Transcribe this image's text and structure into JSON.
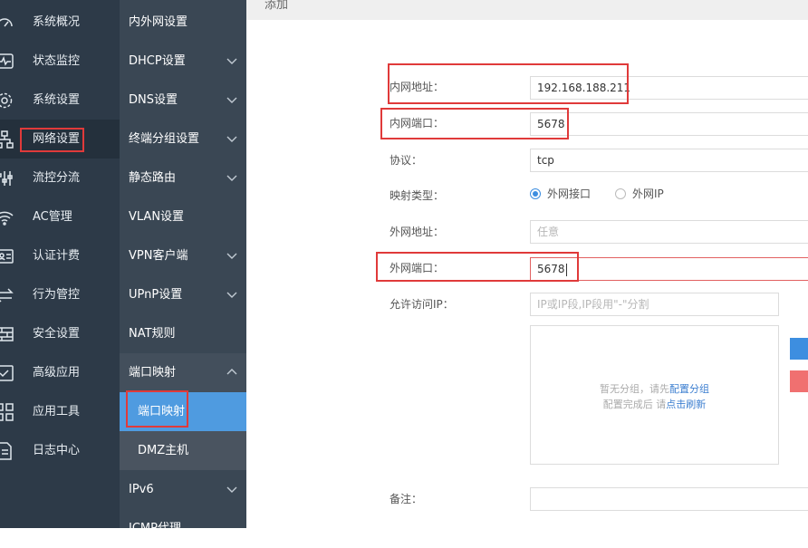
{
  "sidebar": {
    "items": [
      {
        "label": "系统概况",
        "icon": "dashboard-icon"
      },
      {
        "label": "状态监控",
        "icon": "pulse-monitor-icon"
      },
      {
        "label": "系统设置",
        "icon": "gear-icon"
      },
      {
        "label": "网络设置",
        "icon": "network-icon"
      },
      {
        "label": "流控分流",
        "icon": "sliders-icon"
      },
      {
        "label": "AC管理",
        "icon": "wifi-icon"
      },
      {
        "label": "认证计费",
        "icon": "id-card-icon"
      },
      {
        "label": "行为管控",
        "icon": "arrows-exchange-icon"
      },
      {
        "label": "安全设置",
        "icon": "firewall-icon"
      },
      {
        "label": "高级应用",
        "icon": "check-window-icon"
      },
      {
        "label": "应用工具",
        "icon": "tools-grid-icon"
      },
      {
        "label": "日志中心",
        "icon": "log-document-icon"
      }
    ]
  },
  "submenu": {
    "items": [
      {
        "label": "内外网设置"
      },
      {
        "label": "DHCP设置"
      },
      {
        "label": "DNS设置"
      },
      {
        "label": "终端分组设置"
      },
      {
        "label": "静态路由"
      },
      {
        "label": "VLAN设置"
      },
      {
        "label": "VPN客户端"
      },
      {
        "label": "UPnP设置"
      },
      {
        "label": "NAT规则"
      },
      {
        "label": "端口映射"
      },
      {
        "label": "端口映射"
      },
      {
        "label": "DMZ主机"
      },
      {
        "label": "IPv6"
      },
      {
        "label": "ICMP代理"
      }
    ]
  },
  "page": {
    "title": "添加"
  },
  "form": {
    "internal_ip": {
      "label": "内网地址：",
      "value": "192.168.188.211"
    },
    "internal_port": {
      "label": "内网端口：",
      "value": "5678"
    },
    "protocol": {
      "label": "协议：",
      "value": "tcp"
    },
    "mapping_type": {
      "label": "映射类型：",
      "options": [
        "外网接口",
        "外网IP"
      ],
      "selected": "外网接口"
    },
    "external_addr": {
      "label": "外网地址：",
      "placeholder": "任意"
    },
    "external_port": {
      "label": "外网端口：",
      "value": "5678"
    },
    "allowed_ip": {
      "label": "允许访问IP：",
      "placeholder": "IP或IP段,IP段用\"-\"分割"
    },
    "group_box": {
      "line1_prefix": "暂无分组，请先",
      "line1_link": "配置分组",
      "line2_prefix": "配置完成后 请",
      "line2_link": "点击刷新"
    },
    "remark": {
      "label": "备注："
    }
  },
  "colors": {
    "sidebar": "#2d3a48",
    "submenu": "#3a4754",
    "selected": "#4f9be0",
    "highlight": "#e03a3a",
    "primary": "#3d8ee0",
    "danger": "#f07070"
  }
}
